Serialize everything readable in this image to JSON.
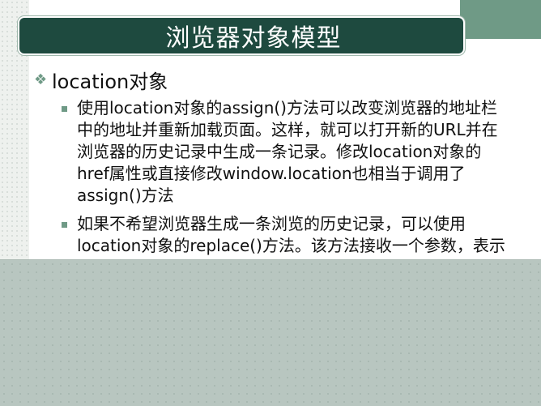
{
  "slide": {
    "title": "浏览器对象模型",
    "section": "location对象",
    "paragraphs": [
      "使用location对象的assign()方法可以改变浏览器的地址栏中的地址并重新加载页面。这样，就可以打开新的URL并在浏览器的历史记录中生成一条记录。修改location对象的href属性或直接修改window.location也相当于调用了assign()方法",
      "如果不希望浏览器生成一条浏览的历史记录，可以使用location对象的replace()方法。该方法接收一个参数，表示要导航到的URL，但是通过该方法无法后退到"
    ]
  },
  "colors": {
    "title_bar": "#1e4a3f",
    "accent": "#6f9a86",
    "overlay": "#b8c6c0"
  }
}
